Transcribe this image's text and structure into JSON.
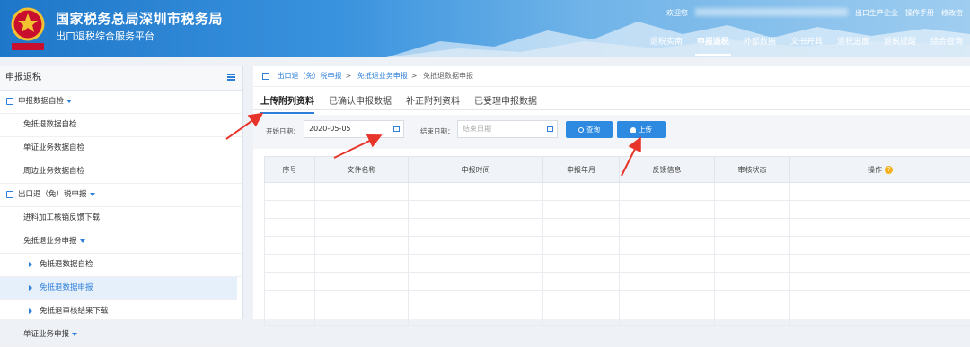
{
  "header": {
    "title": "国家税务总局深圳市税务局",
    "subtitle": "出口退税综合服务平台",
    "welcome": "欢迎您",
    "user_type": "出口生产企业",
    "links": [
      "操作手册",
      "修改密"
    ],
    "nav": [
      {
        "label": "退税实南",
        "active": false
      },
      {
        "label": "申报退税",
        "active": true
      },
      {
        "label": "外部数据",
        "active": false
      },
      {
        "label": "文书开具",
        "active": false
      },
      {
        "label": "退税进度",
        "active": false
      },
      {
        "label": "退税提醒",
        "active": false
      },
      {
        "label": "综合查询",
        "active": false
      }
    ],
    "emblem_text": "中国税务"
  },
  "sidebar": {
    "title": "申报退税",
    "items": [
      {
        "label": "申报数据自检",
        "kind": "group"
      },
      {
        "label": "免抵退数据自检",
        "kind": "l1"
      },
      {
        "label": "单证业务数据自检",
        "kind": "l1"
      },
      {
        "label": "周边业务数据自检",
        "kind": "l1"
      },
      {
        "label": "出口退（免）税申报",
        "kind": "group"
      },
      {
        "label": "进料加工核销反馈下载",
        "kind": "l1"
      },
      {
        "label": "免抵退业务申报",
        "kind": "l1c"
      },
      {
        "label": "免抵退数据自检",
        "kind": "l2"
      },
      {
        "label": "免抵退数据申报",
        "kind": "l2",
        "active": true
      },
      {
        "label": "免抵退审核结果下载",
        "kind": "l2"
      },
      {
        "label": "单证业务申报",
        "kind": "l1c"
      }
    ]
  },
  "breadcrumb": [
    "出口退（免）税申报",
    "免抵退业务申报",
    "免抵退数据申报"
  ],
  "tabs": [
    {
      "label": "上传附列资料",
      "active": true
    },
    {
      "label": "已确认申报数据",
      "active": false
    },
    {
      "label": "补正附列资料",
      "active": false
    },
    {
      "label": "已受理申报数据",
      "active": false
    }
  ],
  "filter": {
    "start_label": "开始日期：",
    "start_value": "2020-05-05",
    "end_label": "结束日期：",
    "end_placeholder": "结束日期",
    "query_label": "查询",
    "upload_label": "上传"
  },
  "table": {
    "columns": [
      "序号",
      "文件名称",
      "申报时间",
      "申报年月",
      "反馈信息",
      "审核状态",
      "操作"
    ],
    "help_glyph": "?",
    "empty_rows": 8
  },
  "colors": {
    "accent": "#2e8ae0",
    "annotation_arrow": "#e8352b",
    "help_icon": "#f3b01b"
  }
}
